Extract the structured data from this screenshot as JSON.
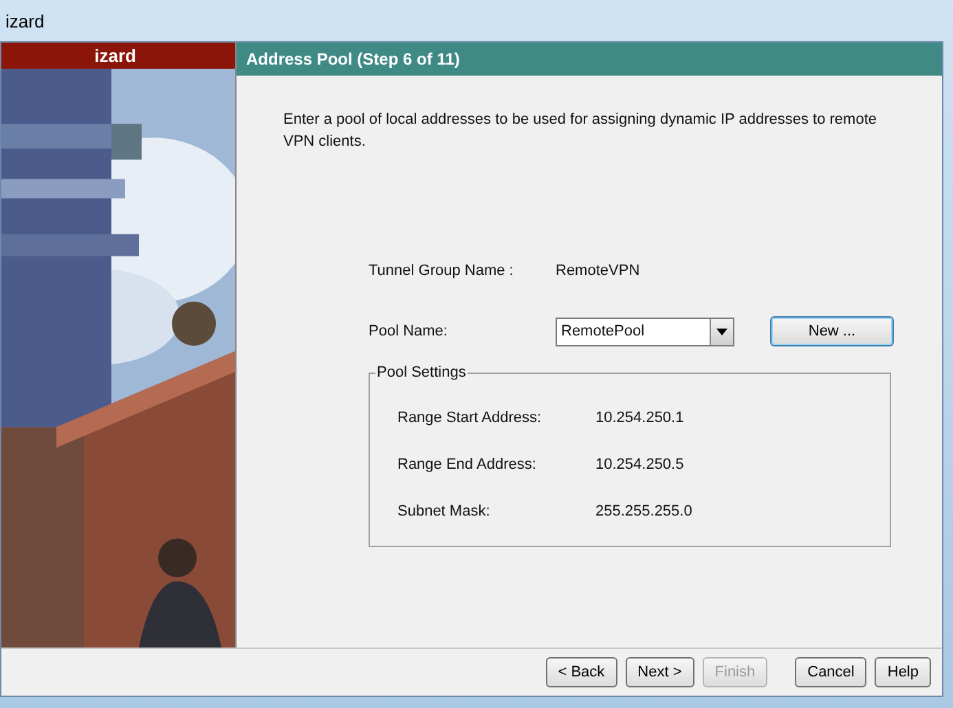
{
  "window": {
    "title": "izard"
  },
  "sidebar": {
    "title": "izard"
  },
  "step": {
    "title": "Address Pool  (Step 6 of 11)",
    "description": "Enter a pool of local addresses to be used for assigning dynamic IP addresses to remote VPN clients."
  },
  "tunnel_group": {
    "label": "Tunnel Group Name :",
    "value": "RemoteVPN"
  },
  "pool_name": {
    "label": "Pool Name:",
    "value": "RemotePool",
    "new_button": "New ..."
  },
  "pool_settings": {
    "title": "Pool Settings",
    "rows": [
      {
        "label": "Range Start Address:",
        "value": "10.254.250.1"
      },
      {
        "label": "Range End Address:",
        "value": "10.254.250.5"
      },
      {
        "label": "Subnet Mask:",
        "value": "255.255.255.0"
      }
    ]
  },
  "buttons": [
    {
      "label": "< Back",
      "disabled": false
    },
    {
      "label": "Next >",
      "disabled": false
    },
    {
      "label": "Finish",
      "disabled": true
    },
    {
      "label": "Cancel",
      "disabled": false
    },
    {
      "label": "Help",
      "disabled": false
    }
  ]
}
